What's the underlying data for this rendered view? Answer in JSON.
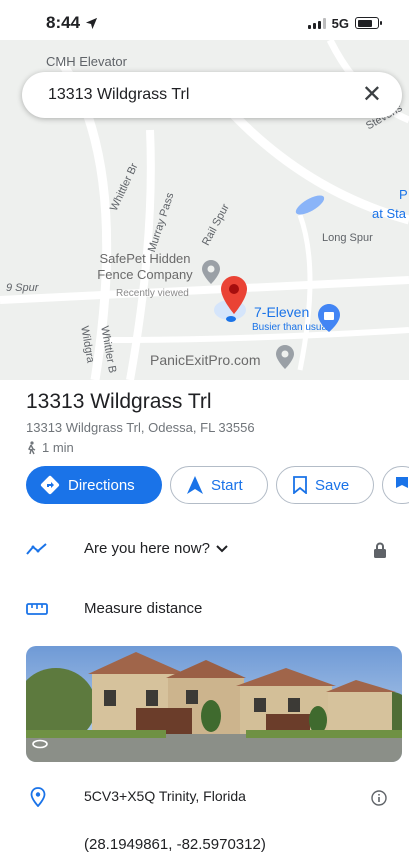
{
  "status_bar": {
    "time": "8:44",
    "network": "5G"
  },
  "search": {
    "query": "13313 Wildgrass Trl",
    "partial_top_label": "CMH Elevator"
  },
  "map": {
    "labels": [
      "Whittler Br",
      "Murray Pass",
      "Rail Spur",
      "Long Spur",
      "Stevens",
      "Whittler B",
      "Wildgra",
      "9 Spur",
      "P",
      "at Sta"
    ],
    "pois": [
      {
        "name": "SafePet Hidden Fence Company",
        "line1": "SafePet Hidden",
        "line2": "Fence Company",
        "sub": "Recently viewed"
      },
      {
        "name": "7-Eleven",
        "sub": "Busier than usual"
      },
      {
        "name": "PanicExitPro.com"
      }
    ]
  },
  "place": {
    "title": "13313 Wildgrass Trl",
    "address": "13313 Wildgrass Trl, Odessa, FL 33556",
    "walk_time": "1 min"
  },
  "actions": {
    "directions": "Directions",
    "start": "Start",
    "save": "Save"
  },
  "rows": {
    "here_now": "Are you here now?",
    "measure": "Measure distance",
    "plus_code": "5CV3+X5Q Trinity, Florida",
    "coordinates": "(28.1949861, -82.5970312)"
  },
  "colors": {
    "accent": "#1a73e8",
    "pin": "#ea4335"
  }
}
